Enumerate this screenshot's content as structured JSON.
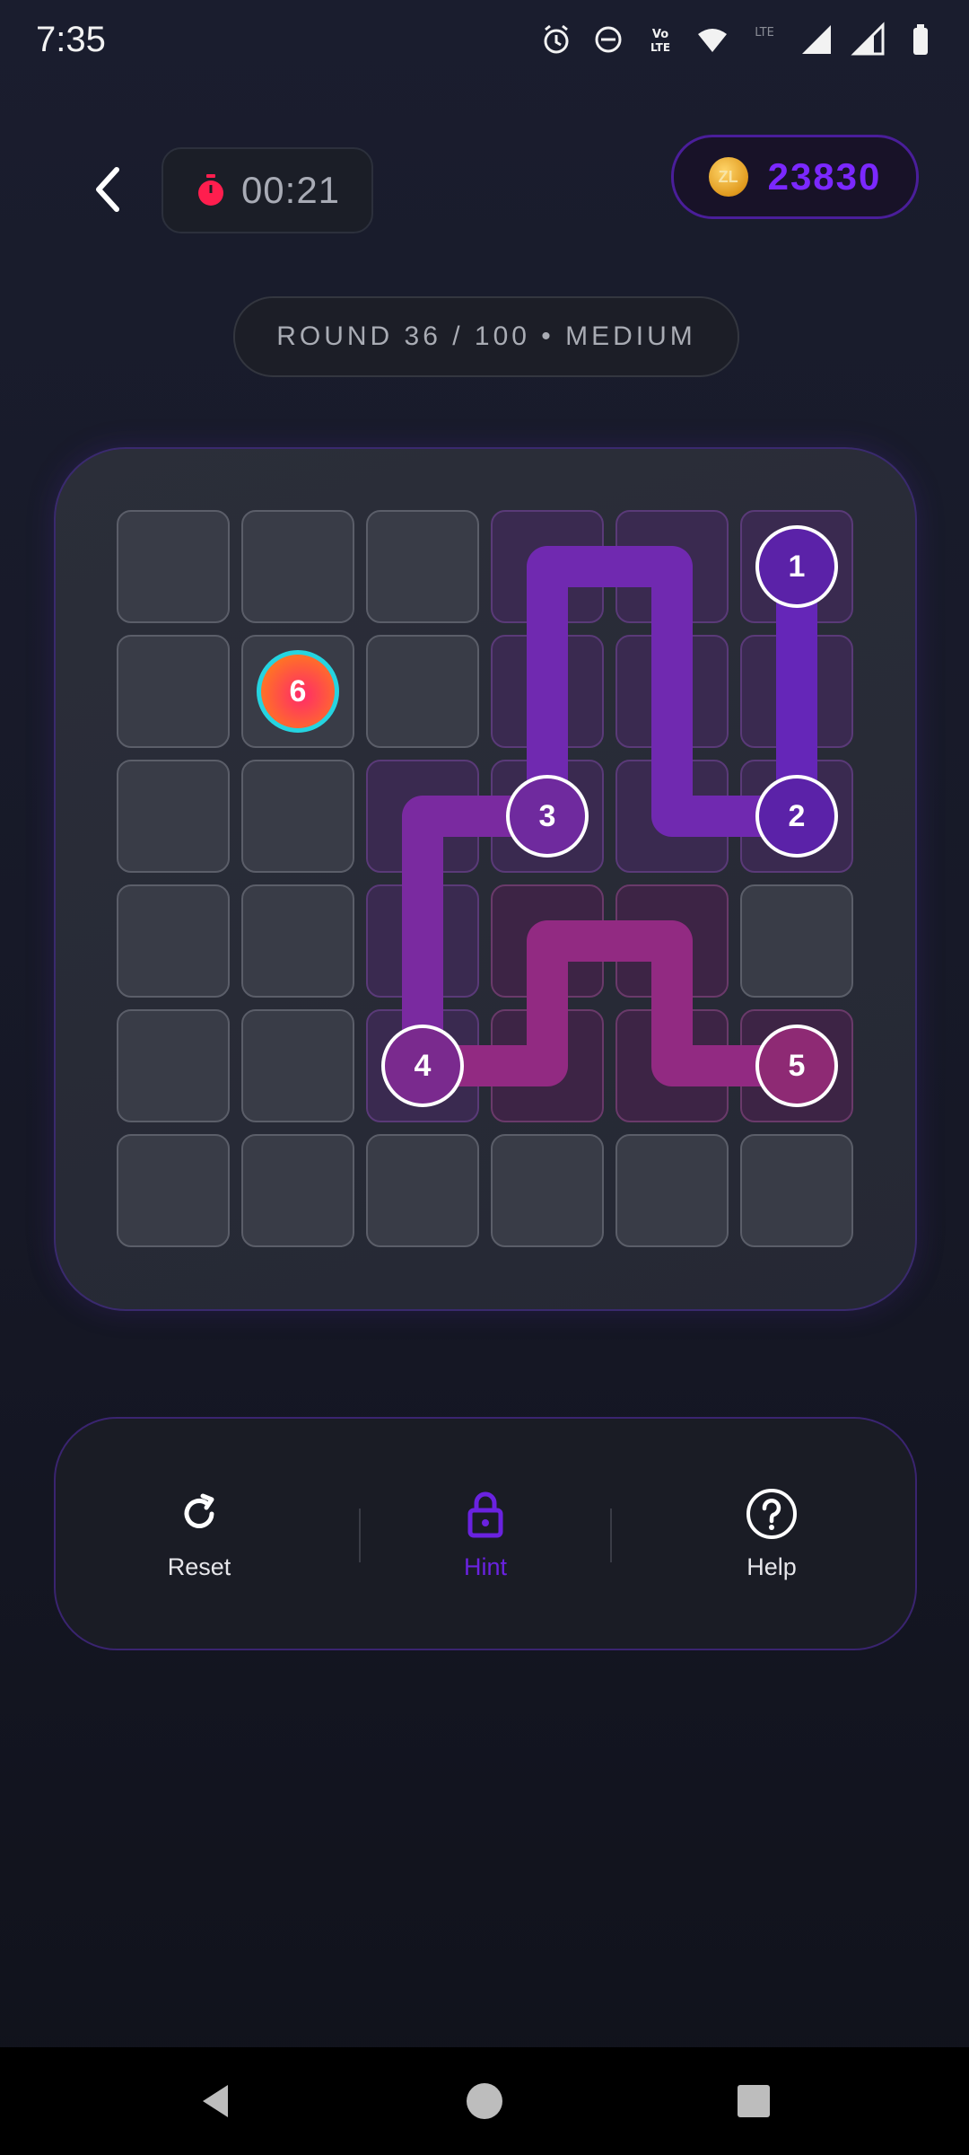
{
  "status_bar": {
    "time": "7:35",
    "icons": [
      "alarm-icon",
      "do-not-disturb-icon",
      "volte-icon",
      "wifi-icon",
      "lte-icon",
      "signal-icon",
      "signal-icon-2",
      "battery-icon"
    ],
    "volte_text": "Vo LTE",
    "lte_text": "LTE"
  },
  "header": {
    "timer": "00:21",
    "coins": "23830",
    "coin_symbol": "ZL"
  },
  "round_label": "ROUND 36 / 100 • MEDIUM",
  "board": {
    "rows": 6,
    "cols": 6,
    "nodes": [
      {
        "label": "1",
        "row": 0,
        "col": 5,
        "color": "#5b22a8"
      },
      {
        "label": "2",
        "row": 2,
        "col": 5,
        "color": "#5b22a8"
      },
      {
        "label": "3",
        "row": 2,
        "col": 3,
        "color": "#6f2a9e"
      },
      {
        "label": "4",
        "row": 4,
        "col": 2,
        "color": "#7a2a8e"
      },
      {
        "label": "5",
        "row": 4,
        "col": 5,
        "color": "#8e2a74"
      },
      {
        "label": "6",
        "row": 1,
        "col": 1,
        "color": "#ff4a3a"
      }
    ],
    "path_colors": {
      "segment_1_2": "#6526b8",
      "segment_2_3": "#7029b0",
      "segment_3_4": "#7a2aa0",
      "segment_4_5": "#922a82"
    }
  },
  "actions": [
    {
      "label": "Reset",
      "icon": "refresh-icon"
    },
    {
      "label": "Hint",
      "icon": "lock-icon",
      "color": "#6a22e0"
    },
    {
      "label": "Help",
      "icon": "help-icon"
    }
  ],
  "nav": [
    "back-icon",
    "home-icon",
    "recents-icon"
  ]
}
